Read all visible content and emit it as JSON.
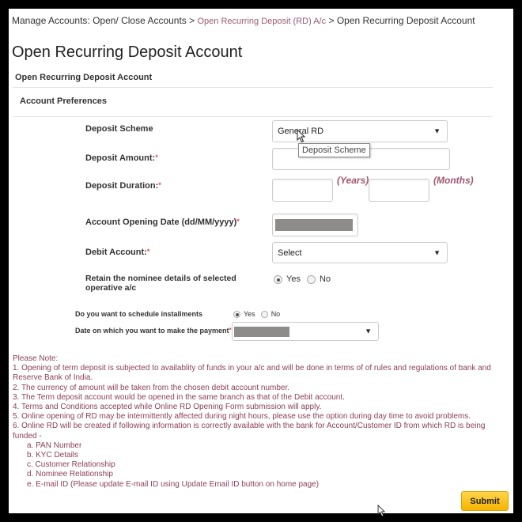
{
  "breadcrumb": {
    "root": "Manage Accounts: Open/ Close Accounts",
    "sep1": " > ",
    "link": "Open Recurring Deposit (RD) A/c",
    "sep2": " > ",
    "current": "Open Recurring Deposit Account"
  },
  "page_title": "Open Recurring Deposit Account",
  "sub_title": "Open Recurring Deposit Account",
  "section_title": "Account Preferences",
  "form": {
    "deposit_scheme": {
      "label": "Deposit Scheme",
      "value": "General RD",
      "tooltip": "Deposit Scheme"
    },
    "deposit_amount": {
      "label": "Deposit Amount:",
      "required": "*",
      "value": ""
    },
    "deposit_duration": {
      "label": "Deposit Duration:",
      "required": "*",
      "years_value": "",
      "months_value": "",
      "years_unit": "(Years)",
      "months_unit": "(Months)"
    },
    "opening_date": {
      "label": "Account Opening Date (dd/MM/yyyy)",
      "required": "*",
      "value": "[masked]"
    },
    "debit_account": {
      "label": "Debit Account:",
      "required": "*",
      "value": "Select"
    },
    "retain_nominee": {
      "label_line1": "Retain the nominee details of selected",
      "label_line2": "operative a/c",
      "options": [
        "Yes",
        "No"
      ],
      "selected": "Yes"
    },
    "schedule_installments": {
      "label": "Do you want to schedule installments",
      "options": [
        "Yes",
        "No"
      ],
      "selected": "Yes"
    },
    "payment_date": {
      "label": "Date on which you want to make the payment",
      "required": "*",
      "value": "[masked]"
    }
  },
  "notes": {
    "heading": "Please Note:",
    "items": [
      "1. Opening of term deposit is subjected to availablity of funds in your a/c and will be done in terms of of rules and regulations of bank and Reserve Bank of India.",
      "2. The currency of amount will be taken from the chosen debit account number.",
      "3. The Term deposit account would be opened in the same branch as that of the Debit account.",
      "4. Terms and Conditions accepted while Online RD Opening Form submission will apply.",
      "5. Online opening of RD may be intermittently affected during night hours, please use the option during day time to avoid problems.",
      "6. Online RD will be created if following information is correctly available with the bank for Account/Customer ID from which RD is being funded -"
    ],
    "sub_items": [
      "a. PAN Number",
      "b. KYC Details",
      "c. Customer Relationship",
      "d. Nominee Relationship",
      "e. E-mail ID (Please update E-mail ID using Update Email ID button on home page)"
    ]
  },
  "submit_label": "Submit",
  "icons": {
    "dropdown": "▼",
    "cursor": "mouse-pointer"
  },
  "colors": {
    "link": "#9b5a72",
    "notes": "#8a3f5a",
    "required": "#d9534f",
    "submit": "#f6b400"
  }
}
